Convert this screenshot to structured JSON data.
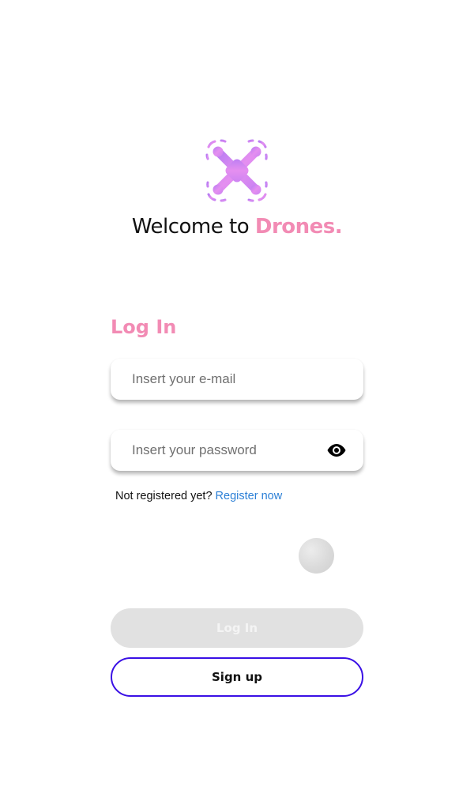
{
  "header": {
    "logo_icon": "drone-icon",
    "welcome_prefix": "Welcome to ",
    "brand_name": "Drones."
  },
  "login": {
    "title": "Log In",
    "email_placeholder": "Insert your e-mail",
    "password_placeholder": "Insert your password",
    "show_password_icon": "eye-icon",
    "register_prompt": "Not registered yet? ",
    "register_link": "Register now"
  },
  "actions": {
    "login_label": "Log In",
    "signup_label": "Sign up"
  },
  "colors": {
    "brand_pink": "#f28bb4",
    "link_blue": "#2b7fd6",
    "signup_border": "#3a10e5",
    "disabled_button": "#e1e1e1"
  }
}
